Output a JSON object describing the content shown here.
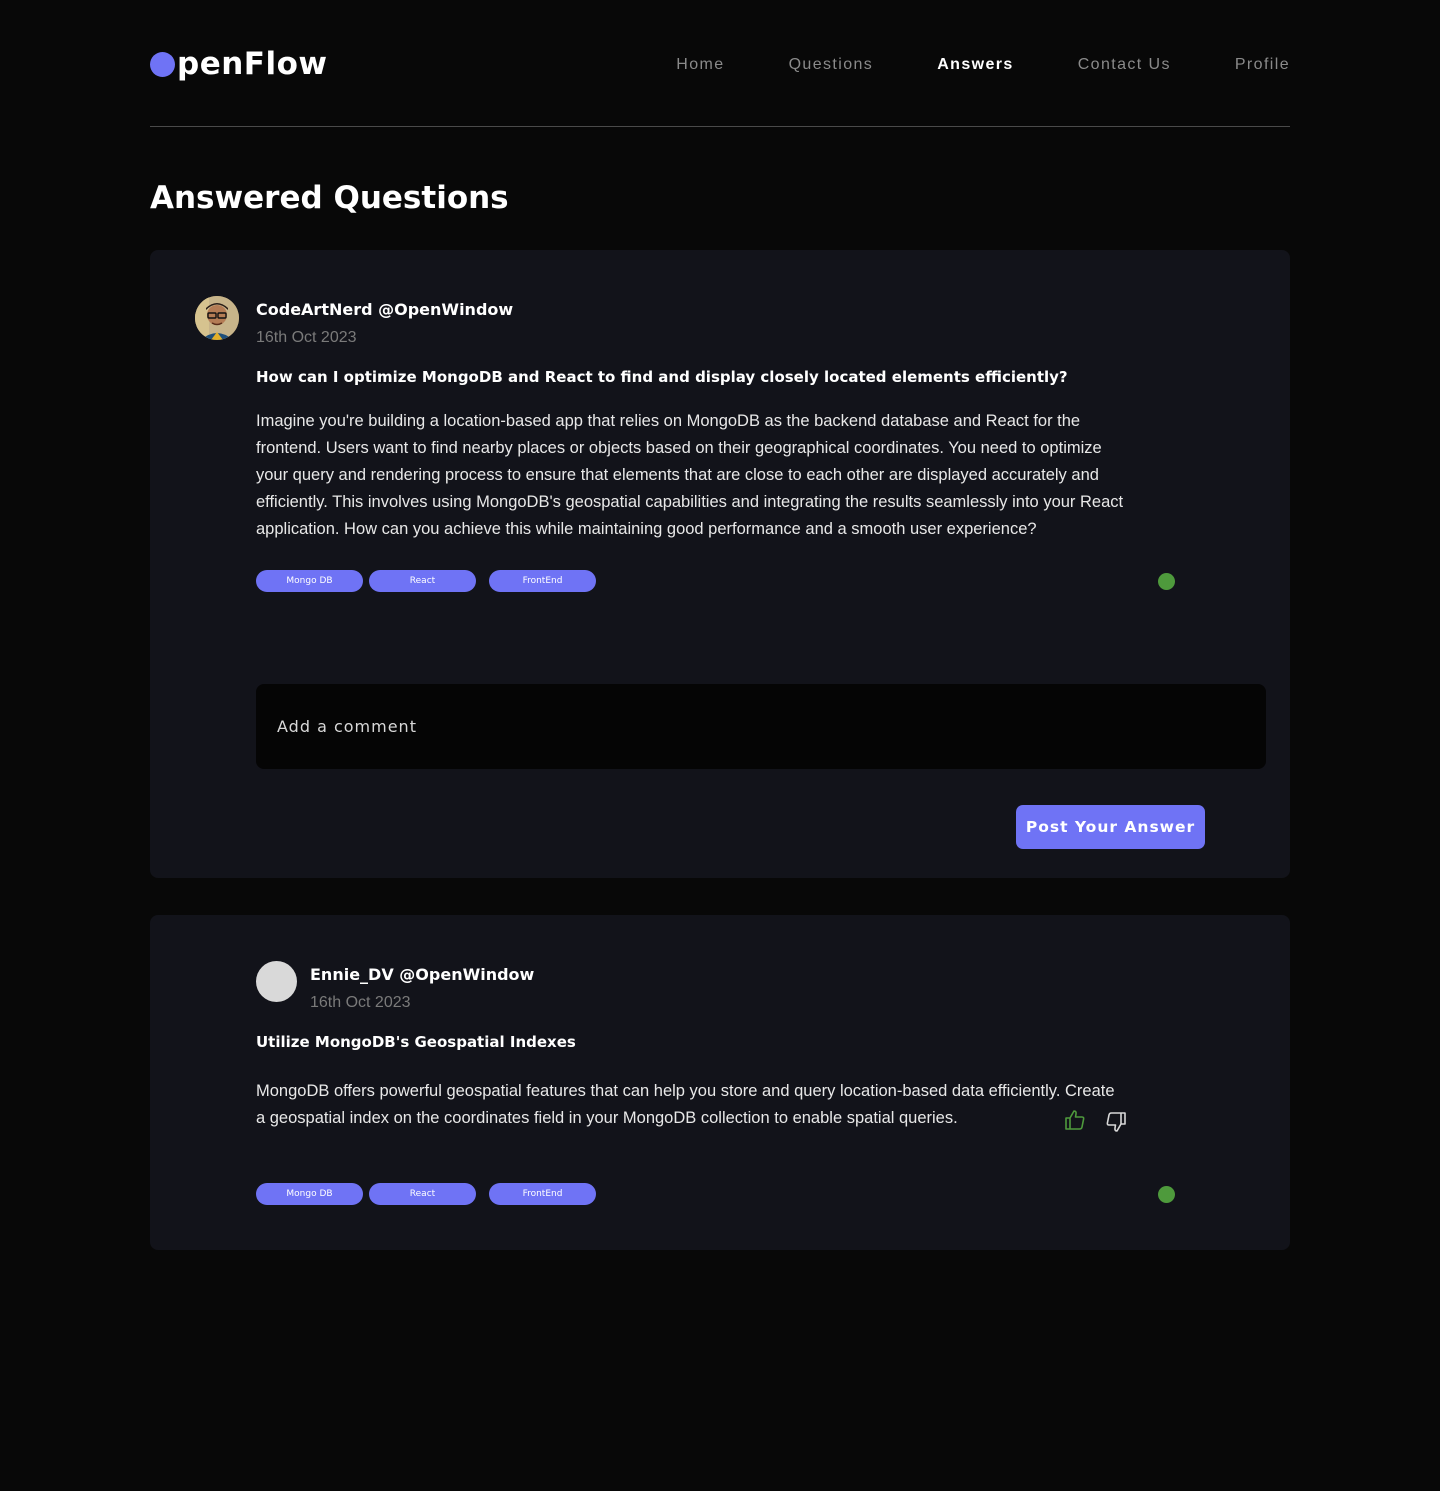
{
  "brand": {
    "name": "penFlow",
    "accent_color": "#6f73f5"
  },
  "nav": {
    "items": [
      {
        "label": "Home"
      },
      {
        "label": "Questions"
      },
      {
        "label": "Answers"
      },
      {
        "label": "Contact Us"
      },
      {
        "label": "Profile"
      }
    ],
    "active": "Answers"
  },
  "page": {
    "title": "Answered Questions"
  },
  "question": {
    "author": "CodeArtNerd @OpenWindow",
    "date": "16th Oct  2023",
    "title": "How can I optimize MongoDB and React to find and display closely located elements efficiently?",
    "body_lines": [
      "Imagine you're building a location-based app that relies on MongoDB as the backend database and React for the",
      "frontend. Users want to find nearby places or objects based on their geographical coordinates. You need to optimize",
      "your query and rendering process to ensure that elements that are close to each other are displayed accurately and",
      "efficiently. This involves using MongoDB's geospatial capabilities and integrating the results seamlessly into your React",
      "application. How can you achieve this while maintaining good performance and a smooth user experience?"
    ],
    "tags": [
      "Mongo DB",
      "React",
      "FrontEnd"
    ],
    "status_color": "#4e9a3c",
    "comment_placeholder": "Add a comment",
    "post_button": "Post Your Answer",
    "avatar_icon": "user-photo-avatar"
  },
  "answer": {
    "author": "Ennie_DV @OpenWindow",
    "date": "16th Oct  2023",
    "title": "Utilize MongoDB's Geospatial Indexes",
    "body_lines": [
      "MongoDB offers powerful geospatial features that can help you store and query location-based data efficiently. Create",
      "a geospatial index on the coordinates field in your MongoDB collection to enable spatial queries."
    ],
    "tags": [
      "Mongo DB",
      "React",
      "FrontEnd"
    ],
    "status_color": "#4e9a3c",
    "upvote_icon": "thumbs-up-icon",
    "downvote_icon": "thumbs-down-icon",
    "upvote_color": "#4e9a3c"
  }
}
